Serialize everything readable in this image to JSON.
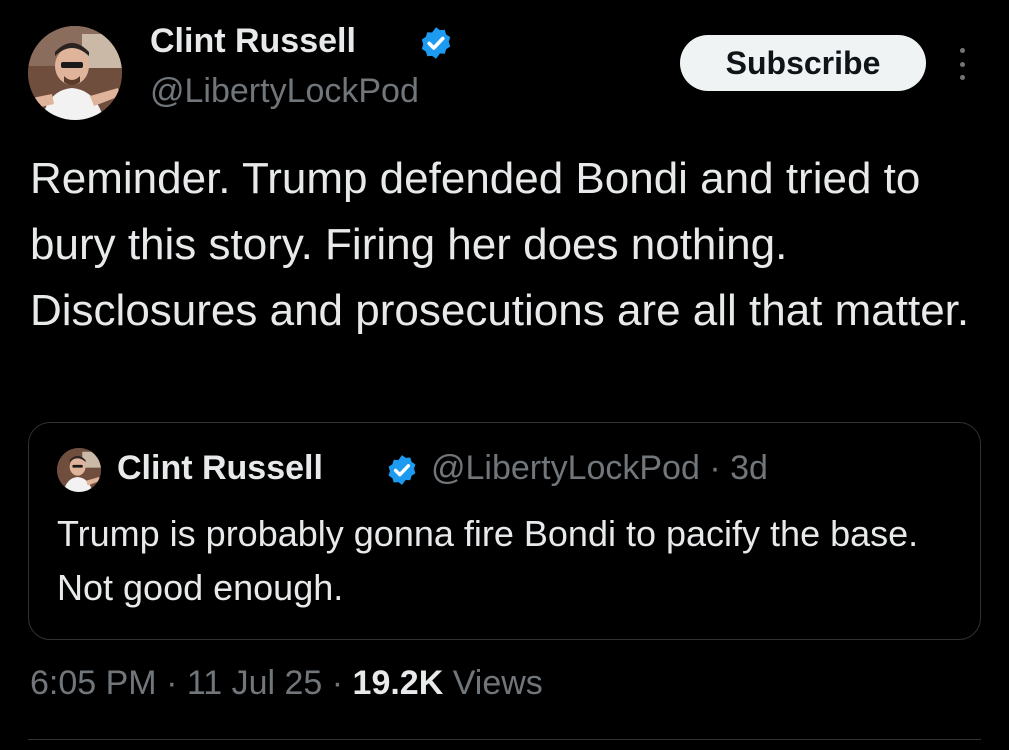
{
  "author": {
    "name": "Clint Russell",
    "handle": "@LibertyLockPod",
    "verified": true
  },
  "header": {
    "subscribe_label": "Subscribe",
    "more_icon": "more-vertical-icon"
  },
  "tweet": {
    "text": "Reminder. Trump defended Bondi and tried to bury this story. Firing her does nothing. Disclosures and prosecutions are all that matter.",
    "time": "6:05 PM",
    "date": "11 Jul 25",
    "separator": " · ",
    "views_count": "19.2K",
    "views_label": " Views"
  },
  "quote": {
    "name": "Clint Russell",
    "handle": "@LibertyLockPod",
    "age": "3d",
    "meta_separator": " · ",
    "text": "Trump is probably gonna fire Bondi to pacify the base. Not good enough."
  },
  "colors": {
    "background": "#000000",
    "primary_text": "#e7e9ea",
    "secondary_text": "#71767b",
    "verified_badge": "#1d9bf0",
    "border": "#2f3336",
    "subscribe_bg": "#eff3f4"
  }
}
